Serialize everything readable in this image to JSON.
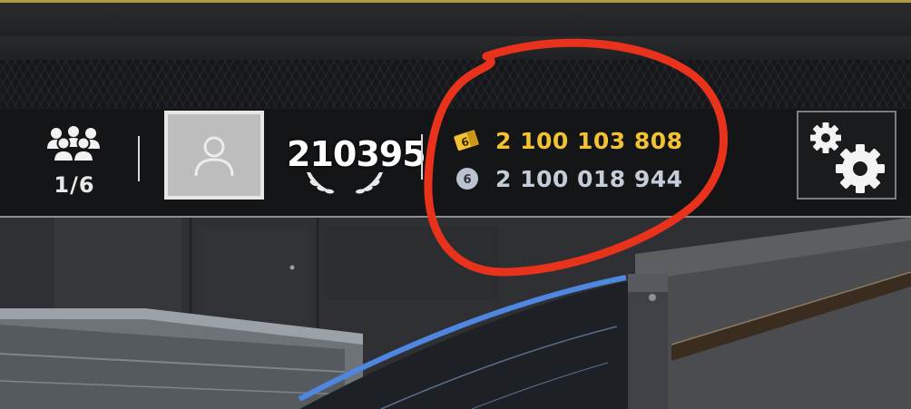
{
  "squad": {
    "icon": "squad-group-icon",
    "count": "1/6"
  },
  "player": {
    "avatar_icon": "default-avatar-icon",
    "level": "210395",
    "level_decoration": "laurel-wreath-icon"
  },
  "currencies": {
    "premium": {
      "icon": "gold-ticket-icon",
      "icon_label": "6",
      "value": "2 100 103 808",
      "color": "#f3c232"
    },
    "standard": {
      "icon": "silver-coin-icon",
      "icon_label": "6",
      "value": "2 100 018 944",
      "color": "#c4ccd8"
    }
  },
  "settings": {
    "icon": "gears-icon"
  },
  "annotation": {
    "color": "#e8321c",
    "shape": "hand-drawn-circle"
  }
}
